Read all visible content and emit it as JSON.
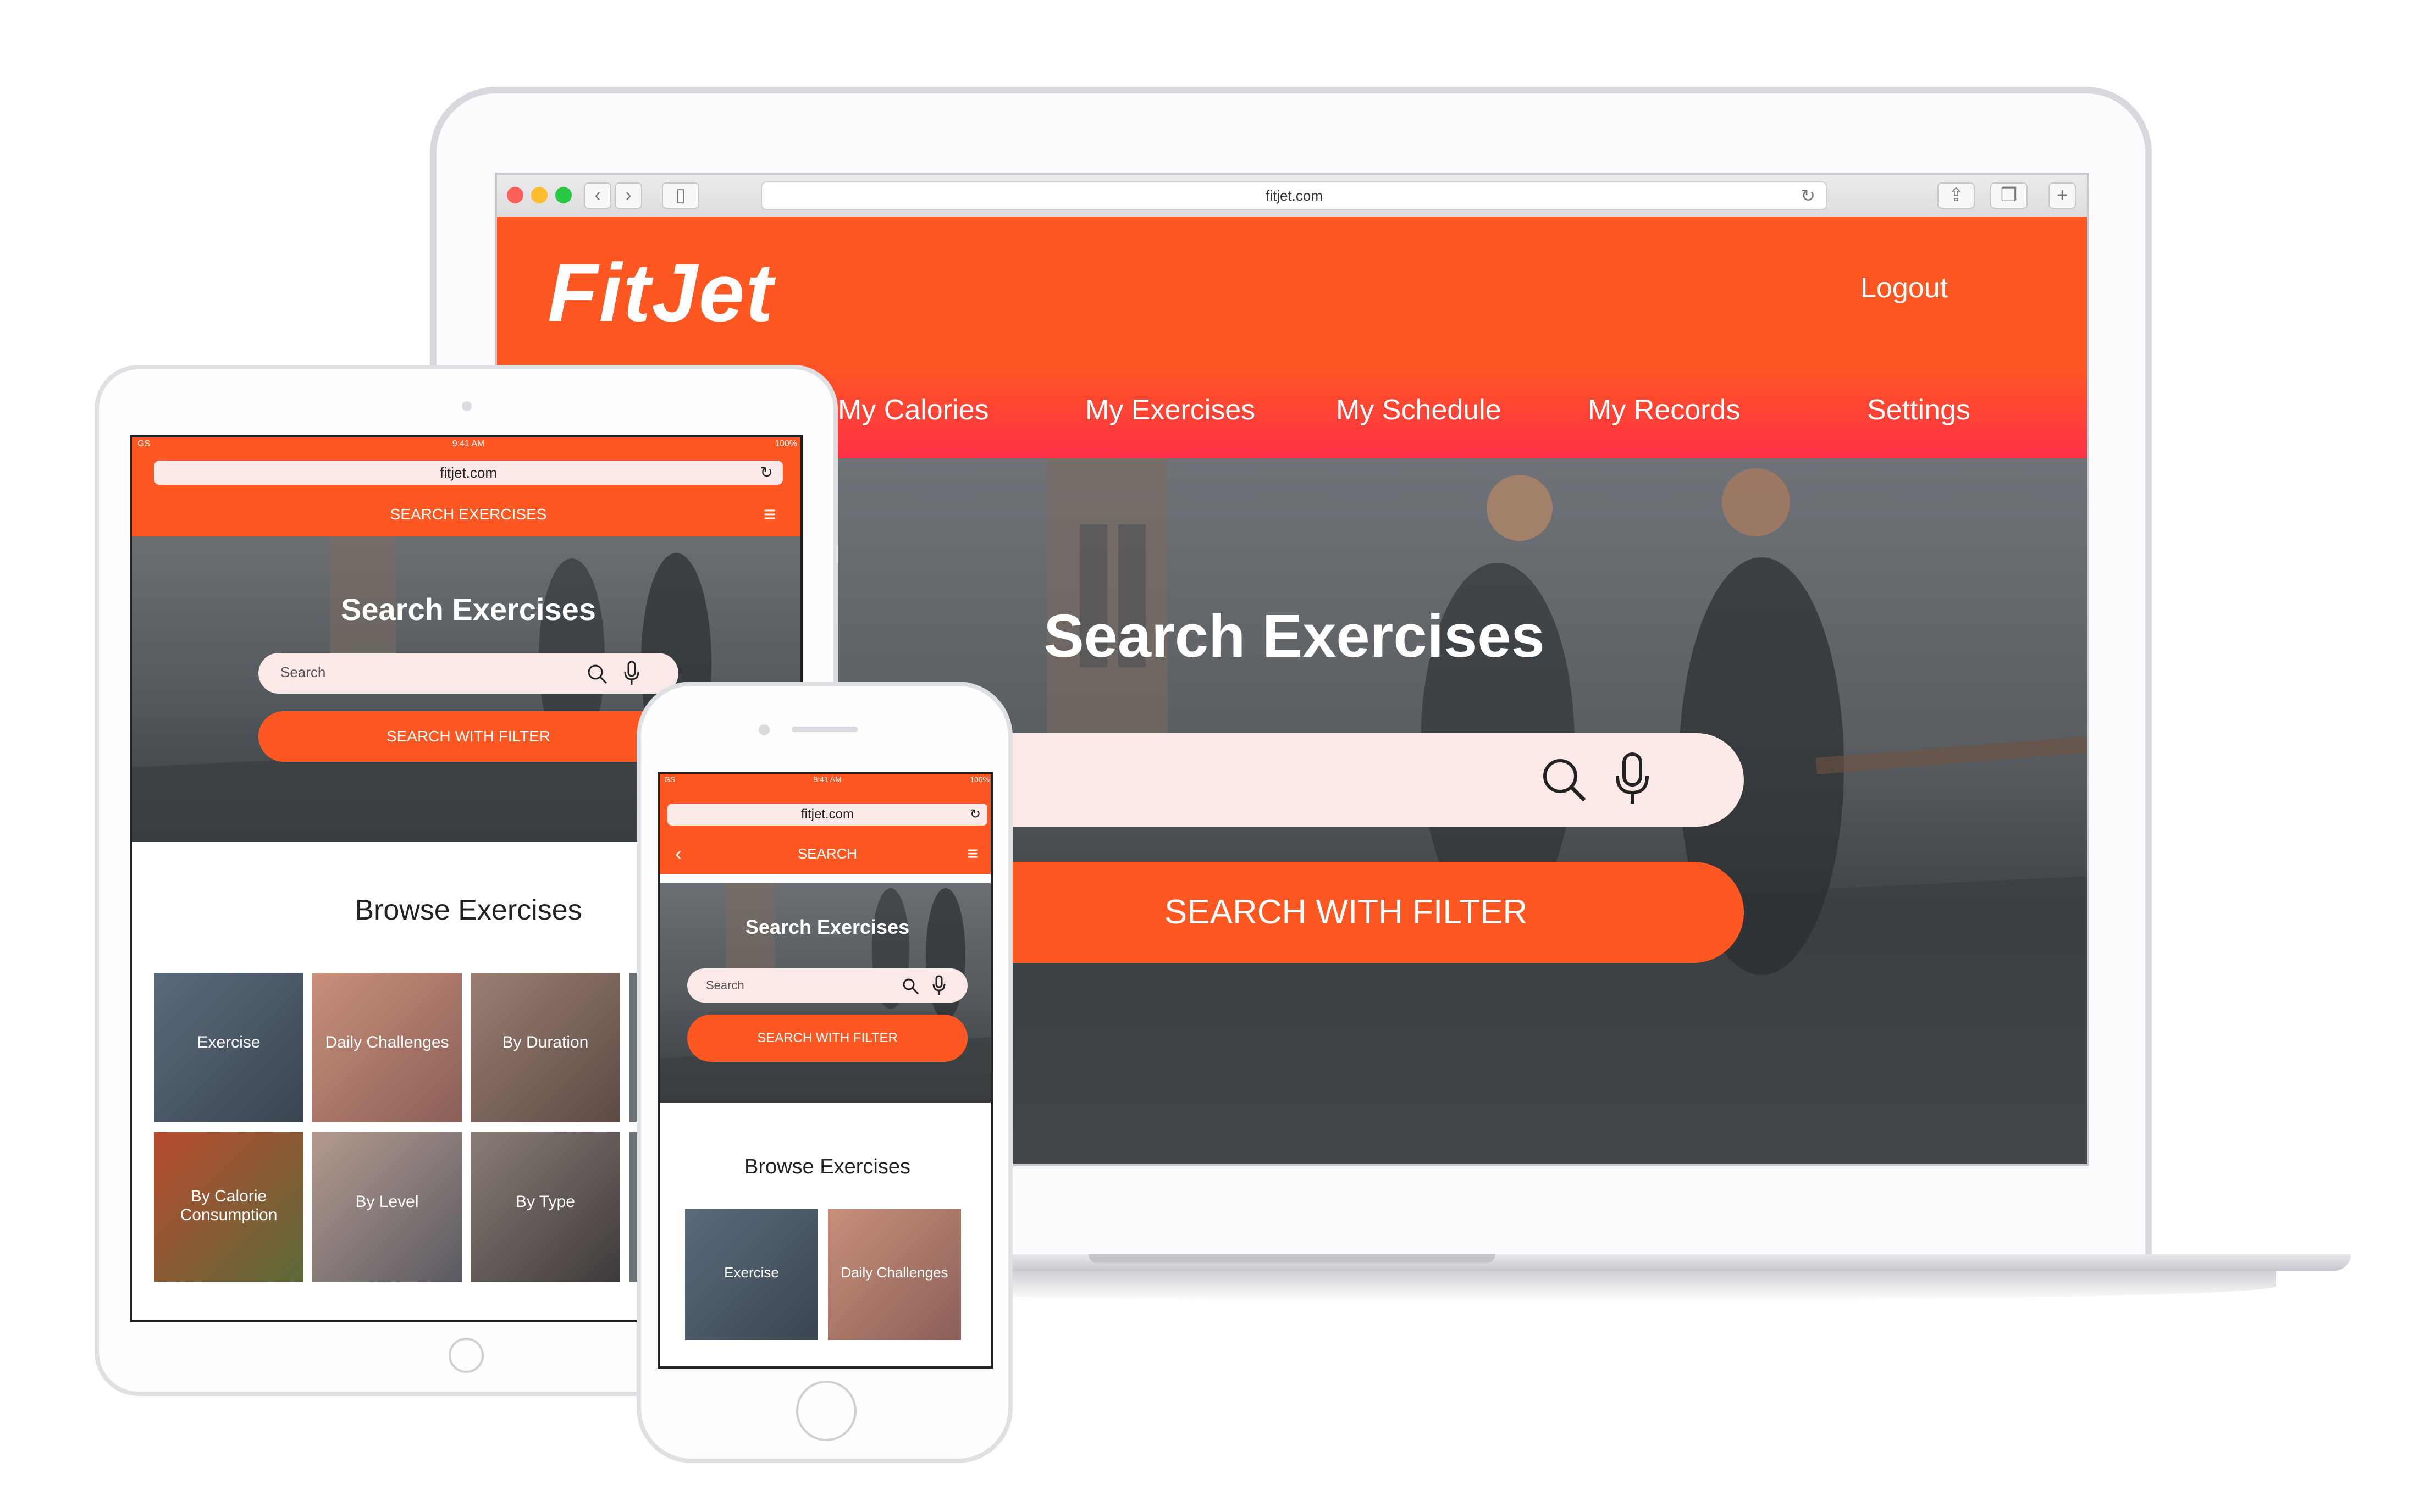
{
  "desktop": {
    "url": "fitjet.com",
    "logo": "FitJet",
    "logout": "Logout",
    "nav": [
      {
        "label": "My Calories"
      },
      {
        "label": "My Exercises"
      },
      {
        "label": "My Schedule"
      },
      {
        "label": "My Records"
      },
      {
        "label": "Settings"
      }
    ],
    "hero_title": "Search Exercises",
    "filter_button": "SEARCH WITH FILTER"
  },
  "tablet": {
    "status_carrier": "GS",
    "status_time": "9:41 AM",
    "status_battery": "100%",
    "url": "fitjet.com",
    "topbar_title": "SEARCH EXERCISES",
    "hero_title": "Search Exercises",
    "search_placeholder": "Search",
    "filter_button": "SEARCH WITH FILTER",
    "browse_title": "Browse Exercises",
    "tiles": [
      {
        "label": "Exercise"
      },
      {
        "label": "Daily Challenges"
      },
      {
        "label": "By Duration"
      },
      {
        "label": "By Calorie Consumption"
      },
      {
        "label": "By Level"
      },
      {
        "label": "By Type"
      }
    ]
  },
  "phone": {
    "status_carrier": "GS",
    "status_time": "9:41 AM",
    "status_battery": "100%",
    "url": "fitjet.com",
    "topbar_title": "SEARCH",
    "hero_title": "Search Exercises",
    "search_placeholder": "Search",
    "filter_button": "SEARCH WITH FILTER",
    "browse_title": "Browse Exercises",
    "tiles": [
      {
        "label": "Exercise"
      },
      {
        "label": "Daily Challenges"
      }
    ]
  },
  "colors": {
    "accent": "#ff5722",
    "accent_gradient_end": "#ff3146",
    "search_bg": "#fbe9e7"
  }
}
